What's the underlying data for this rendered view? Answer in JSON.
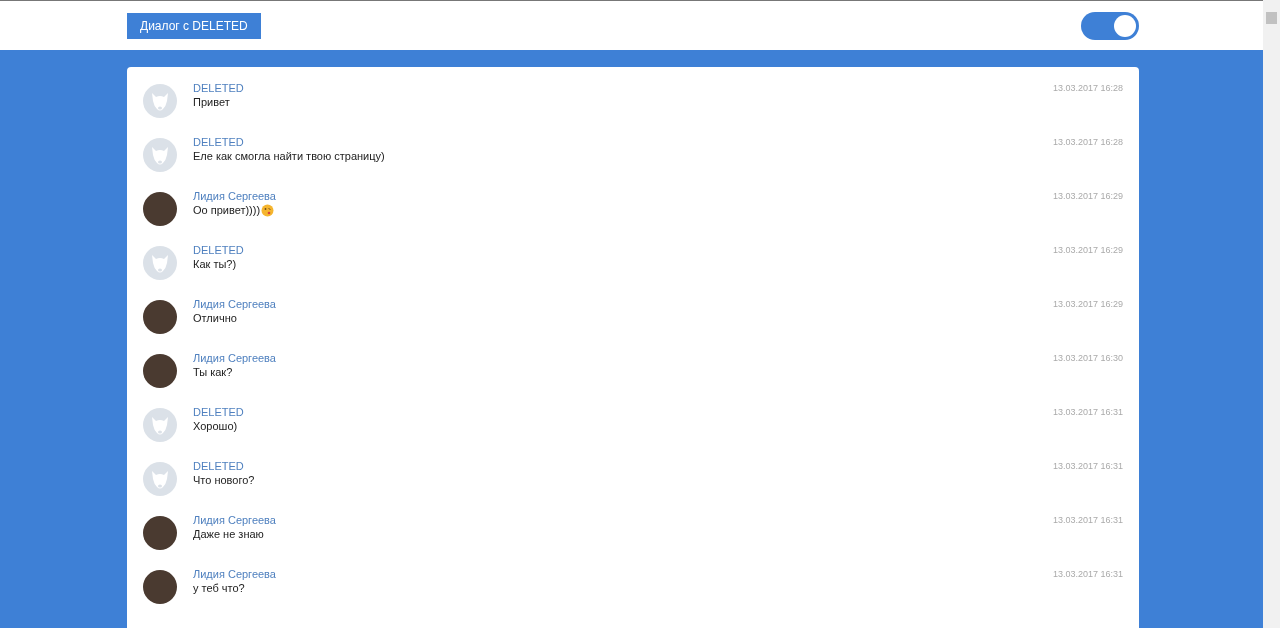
{
  "header": {
    "title_button": "Диалог с DELETED",
    "toggle": {
      "on": true
    }
  },
  "messages": [
    {
      "kind": "deleted",
      "author": "DELETED",
      "text": "Привет",
      "time": "13.03.2017 16:28",
      "emoji": false
    },
    {
      "kind": "deleted",
      "author": "DELETED",
      "text": "Еле как смогла найти твою страницу)",
      "time": "13.03.2017 16:28",
      "emoji": false
    },
    {
      "kind": "photo",
      "author": "Лидия Сергеева",
      "text": "Оо привет))))",
      "time": "13.03.2017 16:29",
      "emoji": true
    },
    {
      "kind": "deleted",
      "author": "DELETED",
      "text": "Как ты?)",
      "time": "13.03.2017 16:29",
      "emoji": false
    },
    {
      "kind": "photo",
      "author": "Лидия Сергеева",
      "text": "Отлично",
      "time": "13.03.2017 16:29",
      "emoji": false
    },
    {
      "kind": "photo",
      "author": "Лидия Сергеева",
      "text": "Ты как?",
      "time": "13.03.2017 16:30",
      "emoji": false
    },
    {
      "kind": "deleted",
      "author": "DELETED",
      "text": "Хорошо)",
      "time": "13.03.2017 16:31",
      "emoji": false
    },
    {
      "kind": "deleted",
      "author": "DELETED",
      "text": "Что нового?",
      "time": "13.03.2017 16:31",
      "emoji": false
    },
    {
      "kind": "photo",
      "author": "Лидия Сергеева",
      "text": "Даже не знаю",
      "time": "13.03.2017 16:31",
      "emoji": false
    },
    {
      "kind": "photo",
      "author": "Лидия Сергеева",
      "text": "у теб что?",
      "time": "13.03.2017 16:31",
      "emoji": false
    }
  ]
}
